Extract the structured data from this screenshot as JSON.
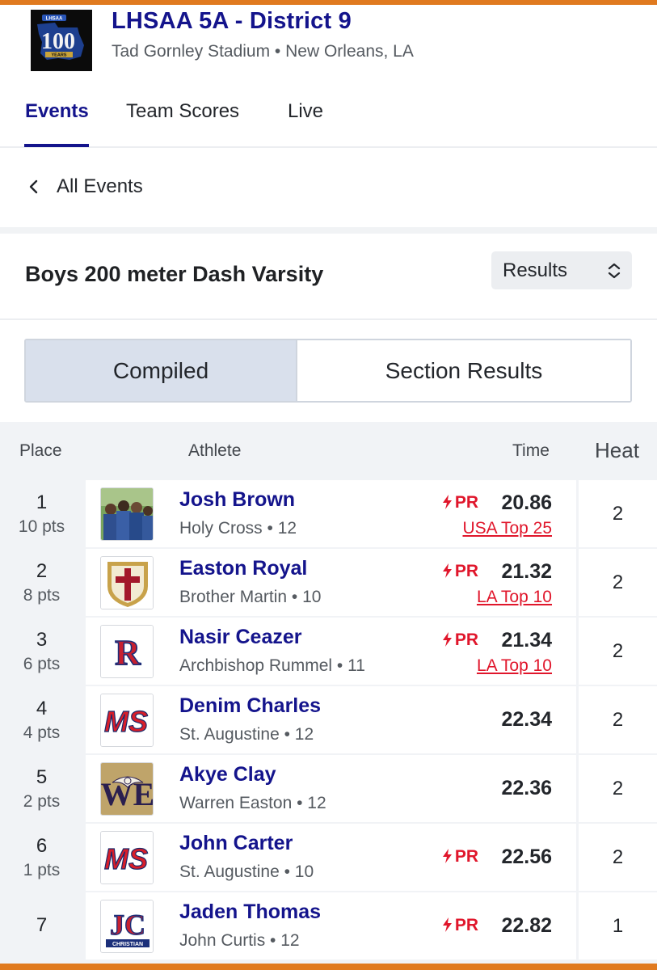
{
  "meet": {
    "title": "LHSAA 5A - District 9",
    "subtitle": "Tad Gornley Stadium • New Orleans, LA",
    "logo": {
      "text_top": "LHSAA",
      "text_big": "100",
      "text_small": "YEARS"
    }
  },
  "tabs": [
    {
      "label": "Events",
      "active": true
    },
    {
      "label": "Team Scores",
      "active": false
    },
    {
      "label": "Live",
      "active": false
    }
  ],
  "back": {
    "label": "All Events",
    "icon": "chevron-left-icon"
  },
  "event": {
    "title": "Boys 200 meter Dash Varsity",
    "select_value": "Results",
    "select_icon": "chevron-up-down-icon"
  },
  "segments": {
    "left": "Compiled",
    "right": "Section Results",
    "active": "left"
  },
  "table": {
    "headers": {
      "place": "Place",
      "athlete": "Athlete",
      "time": "Time",
      "heat": "Heat"
    },
    "pr_label": "PR",
    "rows": [
      {
        "place": "1",
        "pts": "10 pts",
        "name": "Josh Brown",
        "team": "Holy Cross • 12",
        "pr": true,
        "time": "20.86",
        "rank": "USA Top 25",
        "heat": "2",
        "logo": "holy-cross-team-photo"
      },
      {
        "place": "2",
        "pts": "8 pts",
        "name": "Easton Royal",
        "team": "Brother Martin • 10",
        "pr": true,
        "time": "21.32",
        "rank": "LA Top 10",
        "heat": "2",
        "logo": "brother-martin-shield-logo"
      },
      {
        "place": "3",
        "pts": "6 pts",
        "name": "Nasir Ceazer",
        "team": "Archbishop Rummel • 11",
        "pr": true,
        "time": "21.34",
        "rank": "LA Top 10",
        "heat": "2",
        "logo": "rummel-r-logo"
      },
      {
        "place": "4",
        "pts": "4 pts",
        "name": "Denim Charles",
        "team": "St. Augustine • 12",
        "pr": false,
        "time": "22.34",
        "rank": "",
        "heat": "2",
        "logo": "st-augustine-ms-logo"
      },
      {
        "place": "5",
        "pts": "2 pts",
        "name": "Akye Clay",
        "team": "Warren Easton • 12",
        "pr": false,
        "time": "22.36",
        "rank": "",
        "heat": "2",
        "logo": "warren-easton-eagle-logo"
      },
      {
        "place": "6",
        "pts": "1 pts",
        "name": "John Carter",
        "team": "St. Augustine • 10",
        "pr": true,
        "time": "22.56",
        "rank": "",
        "heat": "2",
        "logo": "st-augustine-ms-logo"
      },
      {
        "place": "7",
        "pts": "",
        "name": "Jaden Thomas",
        "team": "John Curtis • 12",
        "pr": true,
        "time": "22.82",
        "rank": "",
        "heat": "1",
        "logo": "john-curtis-jc-logo"
      }
    ]
  },
  "colors": {
    "accent_bar": "#e07a1f",
    "title_navy": "#14148c",
    "pr_red": "#e0162b",
    "segment_active": "#d9e0ec",
    "table_bg": "#f1f3f6"
  },
  "logo_text": {
    "ms": "MS",
    "r": "R",
    "jc": "JC",
    "jc_sub": "CHRISTIAN",
    "we": "WE"
  }
}
